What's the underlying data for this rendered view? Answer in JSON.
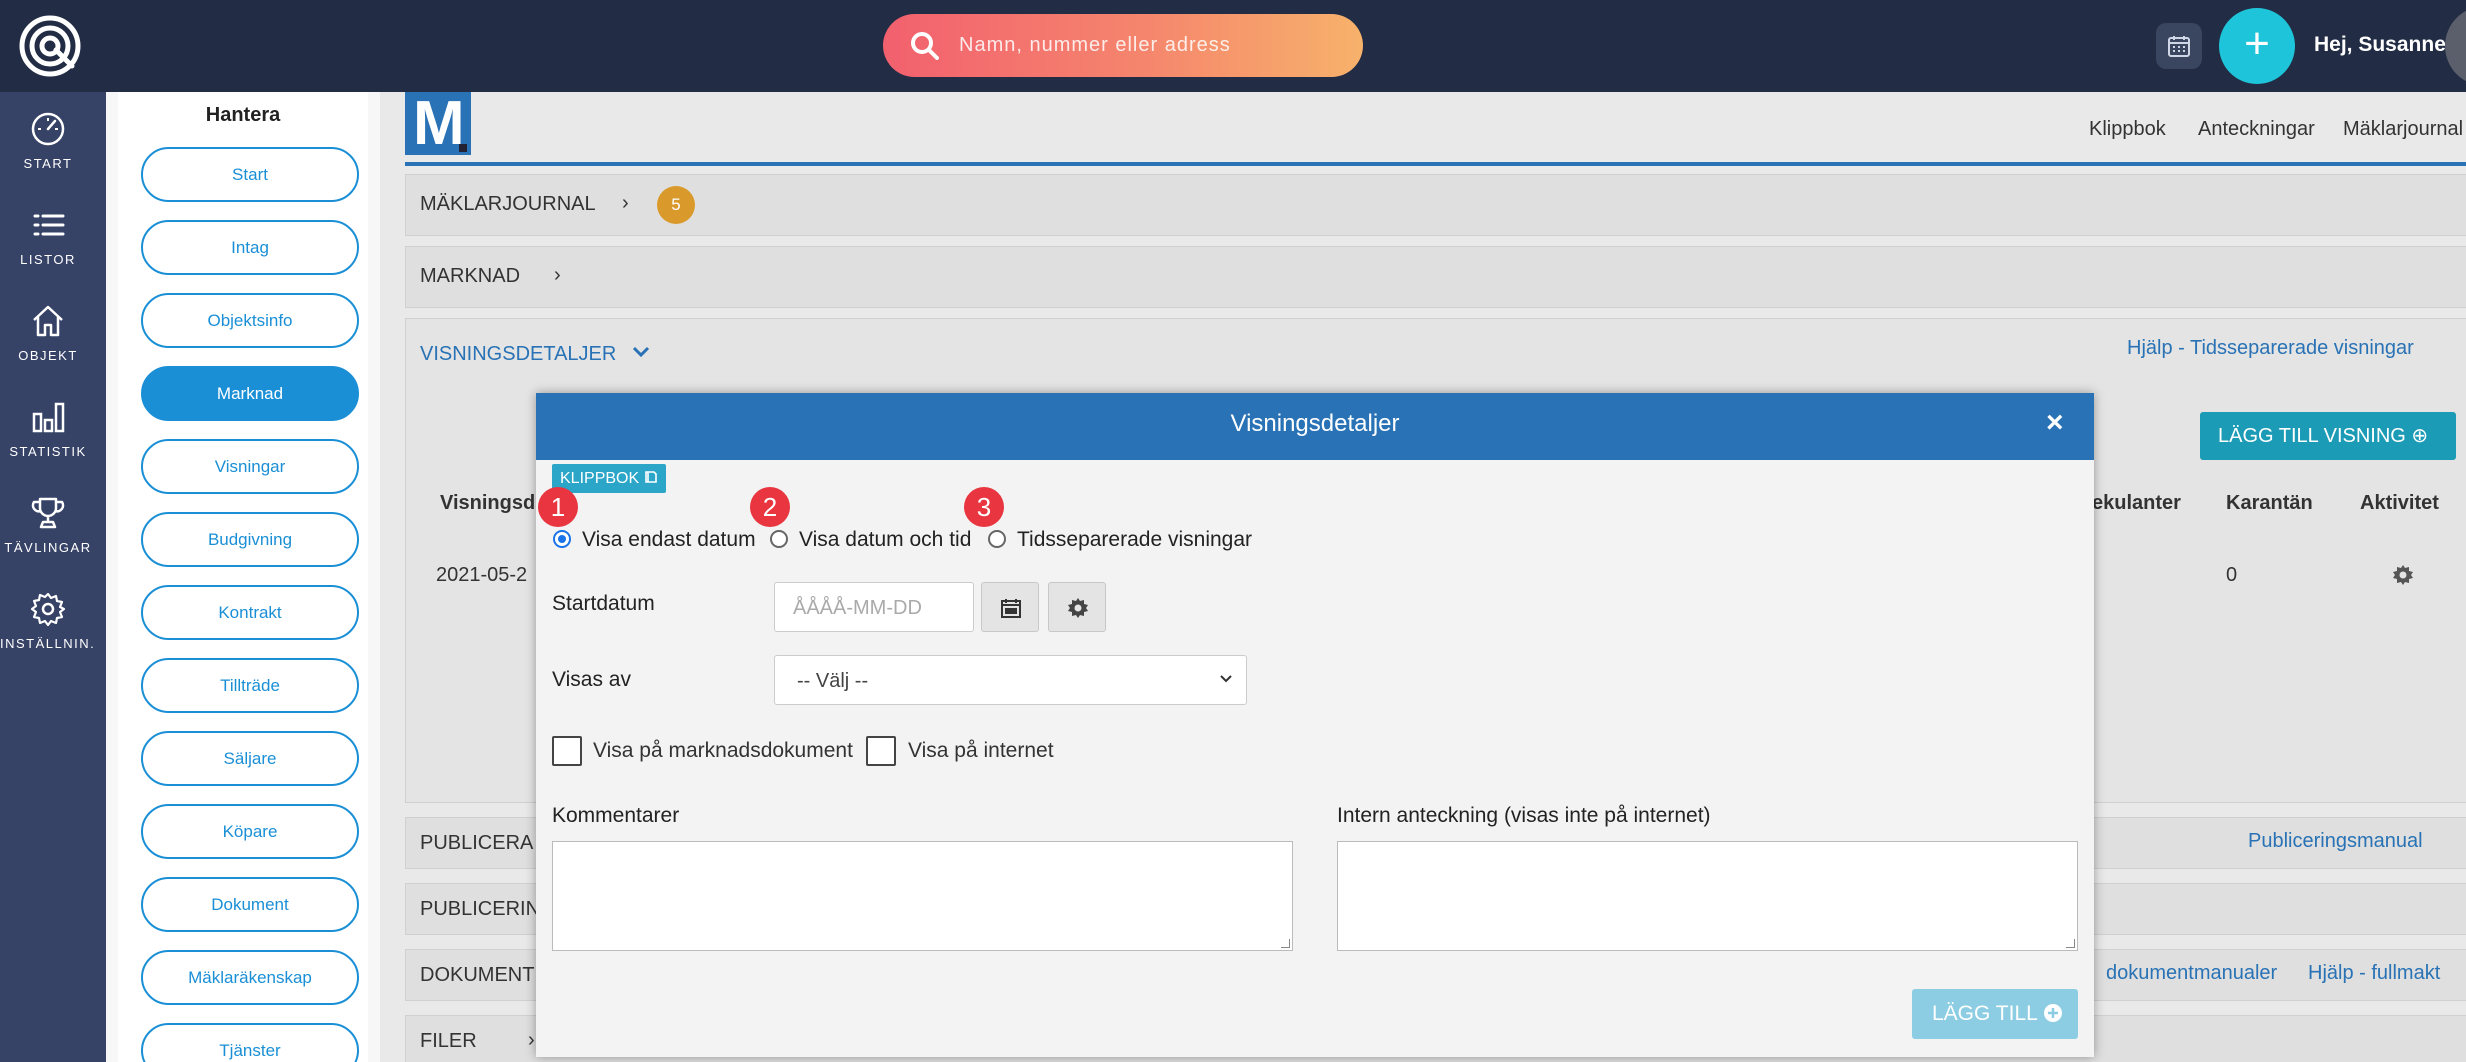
{
  "topbar": {
    "search_placeholder": "Namn, nummer eller adress",
    "greeting": "Hej, Susanne!",
    "plus_label": "+"
  },
  "nav": {
    "items": [
      {
        "label": "START",
        "icon": "gauge-icon"
      },
      {
        "label": "LISTOR",
        "icon": "list-icon"
      },
      {
        "label": "OBJEKT",
        "icon": "home-icon"
      },
      {
        "label": "STATISTIK",
        "icon": "bar-chart-icon"
      },
      {
        "label": "TÄVLINGAR",
        "icon": "trophy-icon"
      },
      {
        "label": "INSTÄLLNIN...",
        "icon": "gear-icon"
      }
    ]
  },
  "hantera": {
    "title": "Hantera",
    "buttons": [
      "Start",
      "Intag",
      "Objektsinfo",
      "Marknad",
      "Visningar",
      "Budgivning",
      "Kontrakt",
      "Tillträde",
      "Säljare",
      "Köpare",
      "Dokument",
      "Mäklaräkenskap",
      "Tjänster"
    ],
    "active": "Marknad"
  },
  "main": {
    "logo_letter": "M",
    "toplinks": [
      "Klippbok",
      "Anteckningar",
      "Mäklarjournal"
    ],
    "sections": {
      "maklarjournal": {
        "title": "MÄKLARJOURNAL",
        "count": "5"
      },
      "marknad": {
        "title": "MARKNAD"
      },
      "visningsdetaljer": {
        "title": "VISNINGSDETALJER",
        "help": "Hjälp - Tidsseparerade visningar"
      },
      "publicera": {
        "title": "PUBLICERA",
        "help": "Publiceringsmanual"
      },
      "publicering": {
        "title": "PUBLICERING"
      },
      "dokument": {
        "title": "DOKUMENT",
        "link1": "dokumentmanualer",
        "link2": "Hjälp - fullmakt"
      },
      "filer": {
        "title": "FILER"
      }
    },
    "lagg_till_visning": "LÄGG TILL VISNING",
    "table": {
      "headers": [
        "Visningsd",
        "ekulanter",
        "Karantän",
        "Aktivitet"
      ],
      "row": {
        "date": "2021-05-2",
        "karantan": "0"
      }
    }
  },
  "modal": {
    "title": "Visningsdetaljer",
    "close": "×",
    "klippbok": "KLIPPBOK",
    "steps": [
      "1",
      "2",
      "3"
    ],
    "radios": [
      "Visa endast datum",
      "Visa datum och tid",
      "Tidsseparerade visningar"
    ],
    "selected_radio": "Visa endast datum",
    "startdatum_label": "Startdatum",
    "startdatum_placeholder": "ÅÅÅÅ-MM-DD",
    "visas_av_label": "Visas av",
    "visas_av_value": "-- Välj --",
    "checkbox_1": "Visa på marknadsdokument",
    "checkbox_2": "Visa på internet",
    "kommentarer_label": "Kommentarer",
    "intern_label": "Intern anteckning (visas inte på internet)",
    "submit": "LÄGG TILL"
  }
}
